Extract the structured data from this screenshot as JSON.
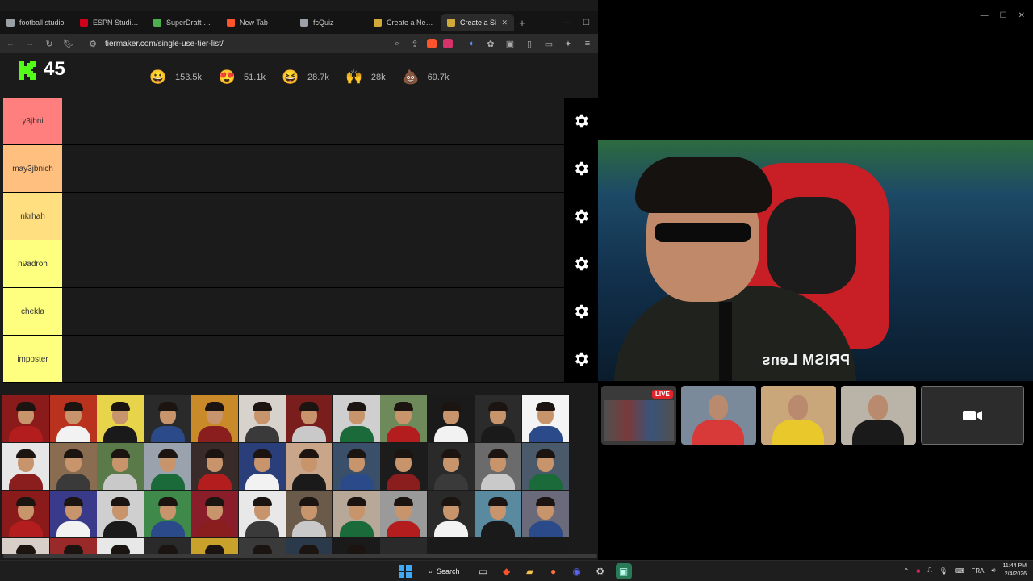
{
  "browser": {
    "tabs": [
      {
        "label": "football studio",
        "fav_color": "#9aa0a6",
        "active": false
      },
      {
        "label": "ESPN Studio Y B",
        "fav_color": "#d0021b",
        "active": false
      },
      {
        "label": "SuperDraft Socc",
        "fav_color": "#4caf50",
        "active": false
      },
      {
        "label": "New Tab",
        "fav_color": "#fb542b",
        "active": false
      },
      {
        "label": "fcQuiz",
        "fav_color": "#9aa0a6",
        "active": false
      },
      {
        "label": "Create a New Ti",
        "fav_color": "#cfa93a",
        "active": false
      },
      {
        "label": "Create a Si",
        "fav_color": "#cfa93a",
        "active": true
      }
    ],
    "new_tab": "+",
    "url": "tiermaker.com/single-use-tier-list/"
  },
  "page": {
    "count": "45",
    "reactions": [
      {
        "icon": "grin-emoji-icon",
        "glyph": "😀",
        "value": "153.5k"
      },
      {
        "icon": "heart-eyes-emoji-icon",
        "glyph": "😍",
        "value": "51.1k"
      },
      {
        "icon": "laugh-emoji-icon",
        "glyph": "😆",
        "value": "28.7k"
      },
      {
        "icon": "clap-emoji-icon",
        "glyph": "🙌",
        "value": "28k"
      },
      {
        "icon": "poop-emoji-icon",
        "glyph": "💩",
        "value": "69.7k"
      }
    ],
    "tiers": [
      {
        "label": "y3jbni",
        "color": "#ff7f7f"
      },
      {
        "label": "may3jbnich",
        "color": "#ffbf7f"
      },
      {
        "label": "nkrhah",
        "color": "#ffdf7f"
      },
      {
        "label": "n9adroh",
        "color": "#ffff7f"
      },
      {
        "label": "chekla",
        "color": "#ffff7f"
      },
      {
        "label": "imposter",
        "color": "#ffff7f"
      }
    ],
    "pool_bg": [
      "#8b1a1a",
      "#b8321e",
      "#e8d44a",
      "#2a2a2a",
      "#c98a2a",
      "#d8d2cc",
      "#7a1d1d",
      "#cfcfcf",
      "#6f8a5a",
      "#1a1a1a",
      "#2b2b2b",
      "#f4f4f4",
      "#e6e6e6",
      "#8a6d50",
      "#5a7a4a",
      "#9aa3ad",
      "#3a2b2b",
      "#2a3f7a",
      "#c9a58a",
      "#3a4f6a",
      "#1c1c1c",
      "#2a2a2a",
      "#6b6b6b",
      "#4a5a6a",
      "#8b1a1a",
      "#3a3a8a",
      "#cfcfcf",
      "#3f8a4a",
      "#8a1d2a",
      "#e8e8e8",
      "#6a5a4a",
      "#b8a898",
      "#9a9a9a",
      "#2a2a2a",
      "#5a8aa0",
      "#6a6a7a",
      "#d8d0c8",
      "#9a2a2a",
      "#e8e8e8",
      "#2a2a2a",
      "#c8a22a",
      "#3a3a3a",
      "#2a3a4a",
      "#1a1a1a",
      "#2a2a2a",
      "#1a1a1a",
      "#1a1a1a",
      "#1a1a1a"
    ]
  },
  "call": {
    "overlay_text": "PRISM Lens",
    "live_badge": "LIVE"
  },
  "taskbar": {
    "search_label": "Search",
    "lang": "FRA",
    "time": "11:44 PM",
    "date": "2/4/2026"
  }
}
